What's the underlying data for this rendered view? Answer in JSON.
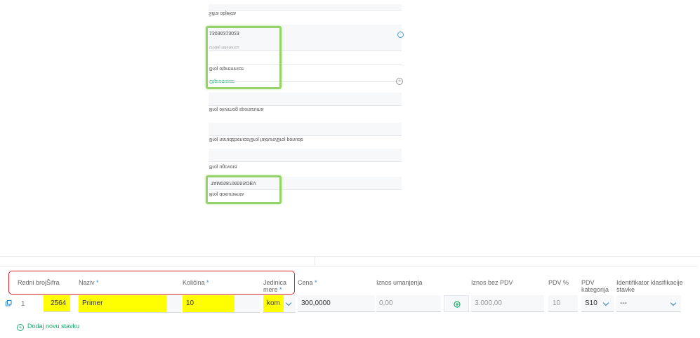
{
  "form": {
    "sifra_objekta_label": "Šifra objekta",
    "field_value_1": "13036313023",
    "field_sub_1": "Dodaj referencu",
    "broj_otpremnice_label": "Broj otpremnice",
    "otpremnice_link": "Otpremnice",
    "broj_okvirnog_label": "Broj okvirnog sporazuma",
    "broj_narudzbenice_label": "Broj narudžbenice/Broj fakture/Broj ponude",
    "broj_ugovora_label": "Broj ugovora",
    "dokument_value": "TAM05870655SOEV",
    "broj_dokumenta_label": "Broj dokumenta"
  },
  "table": {
    "headers": {
      "redni_broj": "Redni broj",
      "sifra": "Šifra",
      "naziv": "Naziv",
      "kolicina": "Količina",
      "jedinica_mere_line1": "Jedinica",
      "jedinica_mere_line2": "mere",
      "cena": "Cena",
      "iznos_umanjenja": "Iznos umanjenja",
      "iznos_bez_pdv": "Iznos bez PDV",
      "pdv_pct": "PDV %",
      "pdv_kategorija_line1": "PDV",
      "pdv_kategorija_line2": "kategorija",
      "identifikator_line1": "Identifikator klasifikacije",
      "identifikator_line2": "stavke",
      "required_mark": "*"
    },
    "row": {
      "redni_broj": "1",
      "sifra": "2564",
      "naziv": "Primer",
      "kolicina": "10",
      "jedinica_mere": "kom",
      "cena": "300,0000",
      "iznos_umanjenja": "0,00",
      "iznos_bez_pdv": "3.000,00",
      "pdv_pct": "10",
      "pdv_kategorija": "S10",
      "identifikator": "---"
    },
    "add_row_label": "Dodaj novu stavku"
  },
  "colors": {
    "highlight_yellow": "#ffff00",
    "green_box": "#95d36a",
    "red_box": "#d9242c",
    "accent_blue": "#2a86c9",
    "accent_green": "#1aaa6a"
  },
  "icons": [
    "copy-icon",
    "gear-icon",
    "plus-circle-icon",
    "chevron-down-icon",
    "calculator-icon"
  ]
}
